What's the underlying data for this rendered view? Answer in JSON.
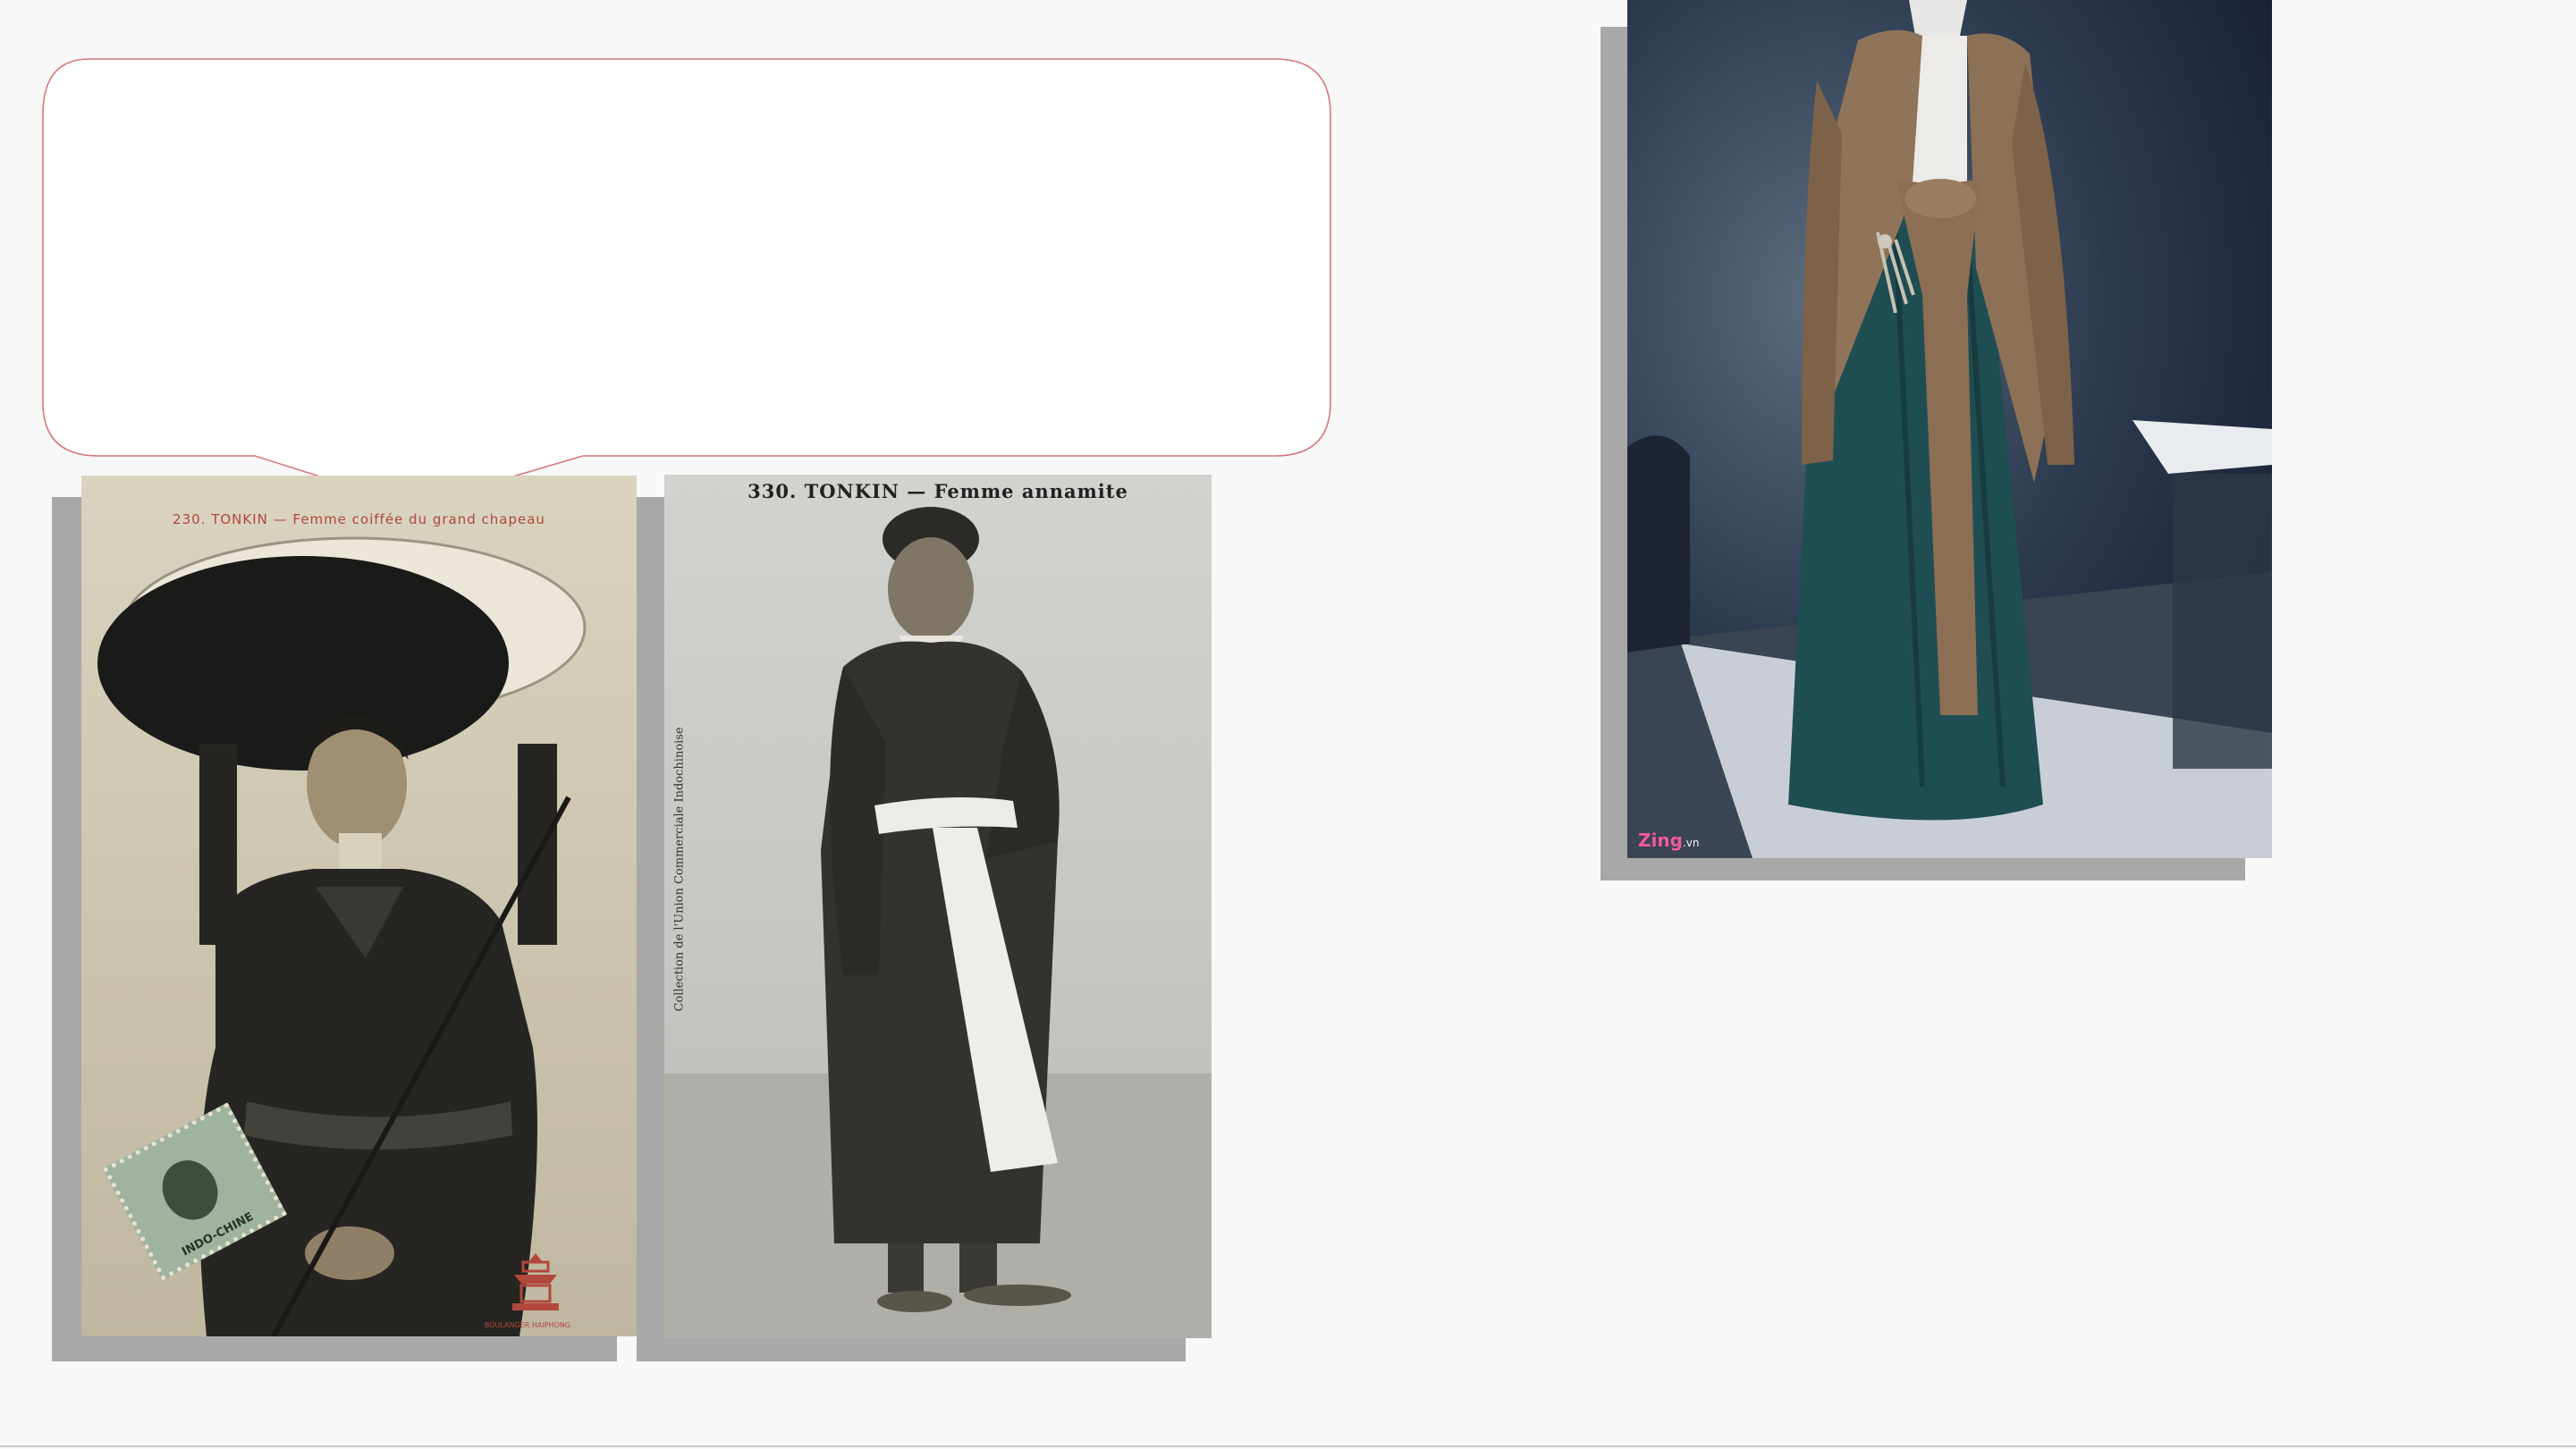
{
  "postcards": [
    {
      "caption": "230.  TONKIN  — Femme coiffée du grand chapeau",
      "stamp_text": "INDO-CHINE",
      "publisher": "BOULANGER HAIPHONG"
    },
    {
      "caption": "330.  TONKIN — Femme annamite",
      "side_text": "Collection de l'Union Commerciale Indochinoise"
    }
  ],
  "museum_photo": {
    "watermark_brand": "Zing",
    "watermark_domain": ".vn"
  },
  "colors": {
    "callout_border": "#d9777c",
    "callout_fill": "#ffffff",
    "page_background": "#f8f8f8",
    "card_shadow": "#a8a8a8",
    "sepia_caption": "#b2473c"
  },
  "icons": {
    "stamp": "postage-stamp-icon",
    "publisher_mark": "pagoda-emblem-icon"
  }
}
